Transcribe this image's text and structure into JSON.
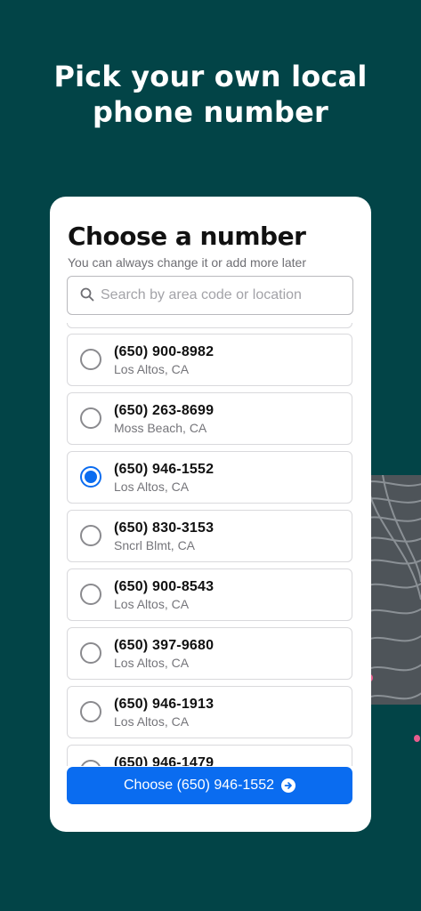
{
  "headline": [
    "Pick your own local",
    "phone number"
  ],
  "card": {
    "title": "Choose a number",
    "subtitle": "You can always change it or add more later",
    "search_placeholder": "Search by area code or location",
    "numbers": [
      {
        "number": "(650) 900-8982",
        "location": "Los Altos, CA",
        "selected": false
      },
      {
        "number": "(650) 263-8699",
        "location": "Moss Beach, CA",
        "selected": false
      },
      {
        "number": "(650) 946-1552",
        "location": "Los Altos, CA",
        "selected": true
      },
      {
        "number": "(650) 830-3153",
        "location": "Sncrl Blmt, CA",
        "selected": false
      },
      {
        "number": "(650) 900-8543",
        "location": "Los Altos, CA",
        "selected": false
      },
      {
        "number": "(650) 397-9680",
        "location": "Los Altos, CA",
        "selected": false
      },
      {
        "number": "(650) 946-1913",
        "location": "Los Altos, CA",
        "selected": false
      },
      {
        "number": "(650) 946-1479",
        "location": "",
        "selected": false
      }
    ],
    "cta_label": "Choose (650) 946-1552"
  },
  "icons": {
    "search": "search-icon",
    "cta": "arrow-right-circle-icon",
    "radio": "radio-icon"
  },
  "colors": {
    "background": "#024447",
    "card": "#ffffff",
    "accent": "#0a6cf0",
    "decor": "#4e5459",
    "dots": "#e85d8e"
  }
}
